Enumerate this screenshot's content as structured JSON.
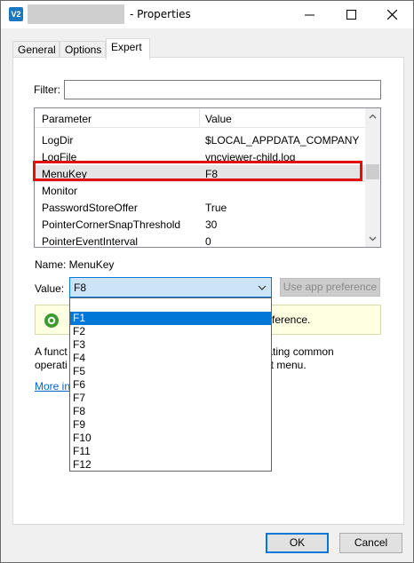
{
  "window": {
    "app_icon_text": "V2",
    "title": "- Properties"
  },
  "tabs": [
    {
      "label": "General"
    },
    {
      "label": "Options"
    },
    {
      "label": "Expert"
    }
  ],
  "filter": {
    "label": "Filter:",
    "value": ""
  },
  "grid": {
    "headers": [
      "Parameter",
      "Value"
    ],
    "rows": [
      {
        "param": "LogDir",
        "value": "$LOCAL_APPDATA_COMPANY"
      },
      {
        "param": "LogFile",
        "value": "vncviewer-child.log"
      },
      {
        "param": "MenuKey",
        "value": "F8"
      },
      {
        "param": "Monitor",
        "value": ""
      },
      {
        "param": "PasswordStoreOffer",
        "value": "True"
      },
      {
        "param": "PointerCornerSnapThreshold",
        "value": "30"
      },
      {
        "param": "PointerEventInterval",
        "value": "0"
      }
    ]
  },
  "details": {
    "name_line": "Name: MenuKey",
    "value_label": "Value:",
    "value_selected": "F8",
    "use_app_button": "Use app preference",
    "info_text_tail": "ference.",
    "desc_head1": "A funct",
    "desc_tail1": "tating common",
    "desc_head2": "operati",
    "desc_tail2": "ut menu.",
    "more_link": "More in"
  },
  "dropdown": {
    "options": [
      "F1",
      "F2",
      "F3",
      "F4",
      "F5",
      "F6",
      "F7",
      "F8",
      "F9",
      "F10",
      "F11",
      "F12"
    ],
    "highlighted": "F1"
  },
  "buttons": {
    "ok": "OK",
    "cancel": "Cancel"
  },
  "colors": {
    "accent": "#0078d7",
    "highlight_border": "#e01010",
    "info_bg": "#ffffe1"
  }
}
